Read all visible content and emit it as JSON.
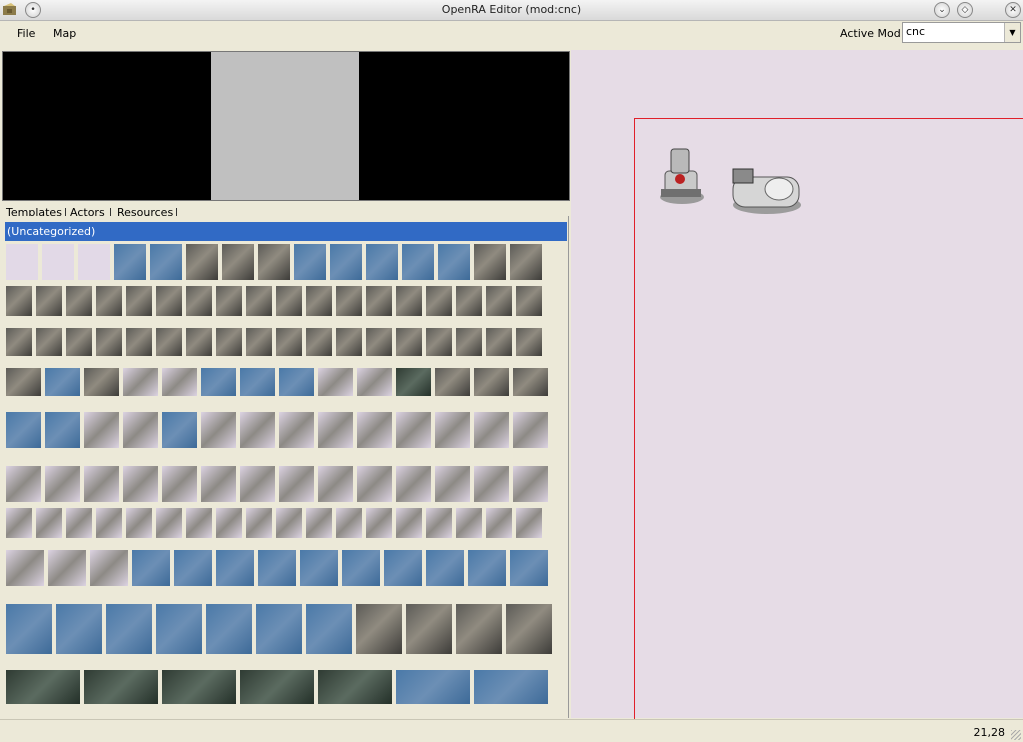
{
  "window": {
    "title": "OpenRA Editor (mod:cnc)"
  },
  "menu": {
    "file": "File",
    "map": "Map"
  },
  "active_mod": {
    "label": "Active Mod:",
    "value": "cnc"
  },
  "tabs": [
    {
      "label": "Templates"
    },
    {
      "label": "Actors"
    },
    {
      "label": "Resources"
    }
  ],
  "palette": {
    "category": "(Uncategorized)"
  },
  "status": {
    "coords": "21,28"
  },
  "colors": {
    "selection": "#316ac5",
    "map_border": "#e0202a",
    "map_background": "#e6dce6"
  }
}
